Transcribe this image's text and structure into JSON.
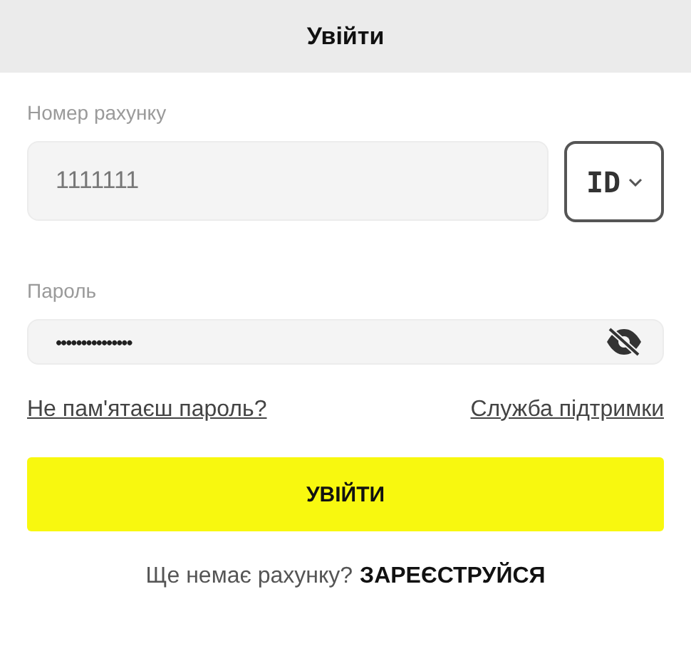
{
  "header": {
    "title": "Увійти"
  },
  "account": {
    "label": "Номер рахунку",
    "value": "1111111",
    "type_select": "ID"
  },
  "password": {
    "label": "Пароль",
    "value": "•••••••••••••••",
    "visible": false
  },
  "links": [
    "Не пам'ятаєш пароль?",
    "Служба підтримки"
  ],
  "submit": "УВІЙТИ",
  "footer": {
    "text": "Ще немає рахунку?",
    "link": "ЗАРЕЄСТРУЙСЯ"
  }
}
